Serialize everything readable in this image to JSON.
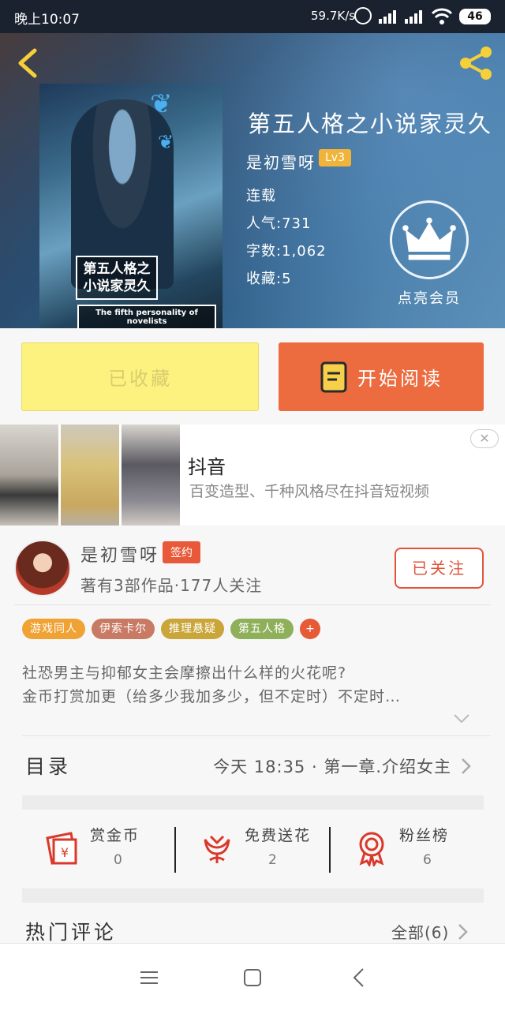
{
  "status_bar": {
    "time": "晚上10:07",
    "network_speed": "59.7K/s",
    "battery": "46"
  },
  "book": {
    "title": "第五人格之小说家灵久",
    "author": "是初雪呀",
    "author_level": "Lv3",
    "status": "连载",
    "popularity": "人气:731",
    "word_count": "字数:1,062",
    "favorites": "收藏:5",
    "cover_title": "第五人格之小说家灵久",
    "cover_subtitle": "The fifth personality of novelists",
    "vip_label": "点亮会员"
  },
  "actions": {
    "favorited_label": "已收藏",
    "start_reading_label": "开始阅读"
  },
  "ad": {
    "title": "抖音",
    "description": "百变造型、千种风格尽在抖音短视频",
    "close": "✕"
  },
  "author_card": {
    "name": "是初雪呀",
    "sign_badge": "签约",
    "stats": "著有3部作品·177人关注",
    "follow_label": "已关注"
  },
  "tags": [
    {
      "label": "游戏同人",
      "color": "#f0a234"
    },
    {
      "label": "伊索卡尔",
      "color": "#c97a64"
    },
    {
      "label": "推理悬疑",
      "color": "#c9a53a"
    },
    {
      "label": "第五人格",
      "color": "#8fb05a"
    }
  ],
  "tag_add": "+",
  "intro": {
    "line1": "社恐男主与抑郁女主会摩擦出什么样的火花呢?",
    "line2": "金币打赏加更（给多少我加多少，但不定时）不定时…"
  },
  "toc": {
    "label": "目录",
    "latest": "今天 18:35 · 第一章.介绍女主"
  },
  "reward": [
    {
      "label": "赏金币",
      "count": "0",
      "icon": "red-envelope-yuan-icon"
    },
    {
      "label": "免费送花",
      "count": "2",
      "icon": "flower-icon"
    },
    {
      "label": "粉丝榜",
      "count": "6",
      "icon": "medal-icon"
    }
  ],
  "comments": {
    "label": "热门评论",
    "all_label": "全部(6)"
  },
  "colors": {
    "accent": "#ec6b3f",
    "favorite_bg": "#fdf27f",
    "badge_gold": "#f0b43a"
  }
}
